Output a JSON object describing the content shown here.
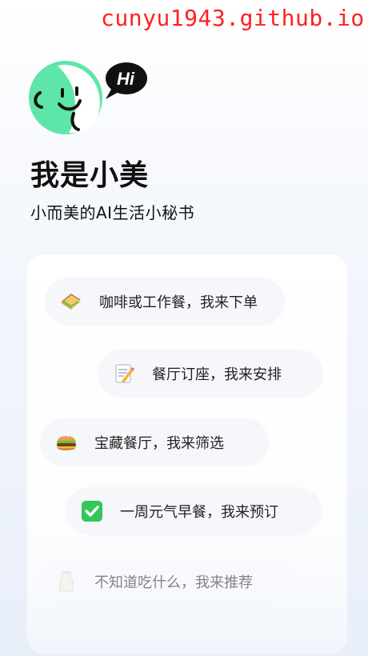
{
  "watermark": "cunyu1943.github.io",
  "avatar": {
    "bubble_text": "Hi"
  },
  "title": "我是小美",
  "subtitle": "小而美的AI生活小秘书",
  "features": [
    {
      "icon": "sandwich-icon",
      "label": "咖啡或工作餐，我来下单"
    },
    {
      "icon": "memo-icon",
      "label": "餐厅订座，我来安排"
    },
    {
      "icon": "burger-icon",
      "label": "宝藏餐厅，我来筛选"
    },
    {
      "icon": "check-icon",
      "label": "一周元气早餐，我来预订"
    },
    {
      "icon": "milk-icon",
      "label": "不知道吃什么，我来推荐"
    }
  ],
  "colors": {
    "accent_green": "#5ee6a8",
    "watermark_red": "#ff2020",
    "check_green": "#34c759"
  }
}
